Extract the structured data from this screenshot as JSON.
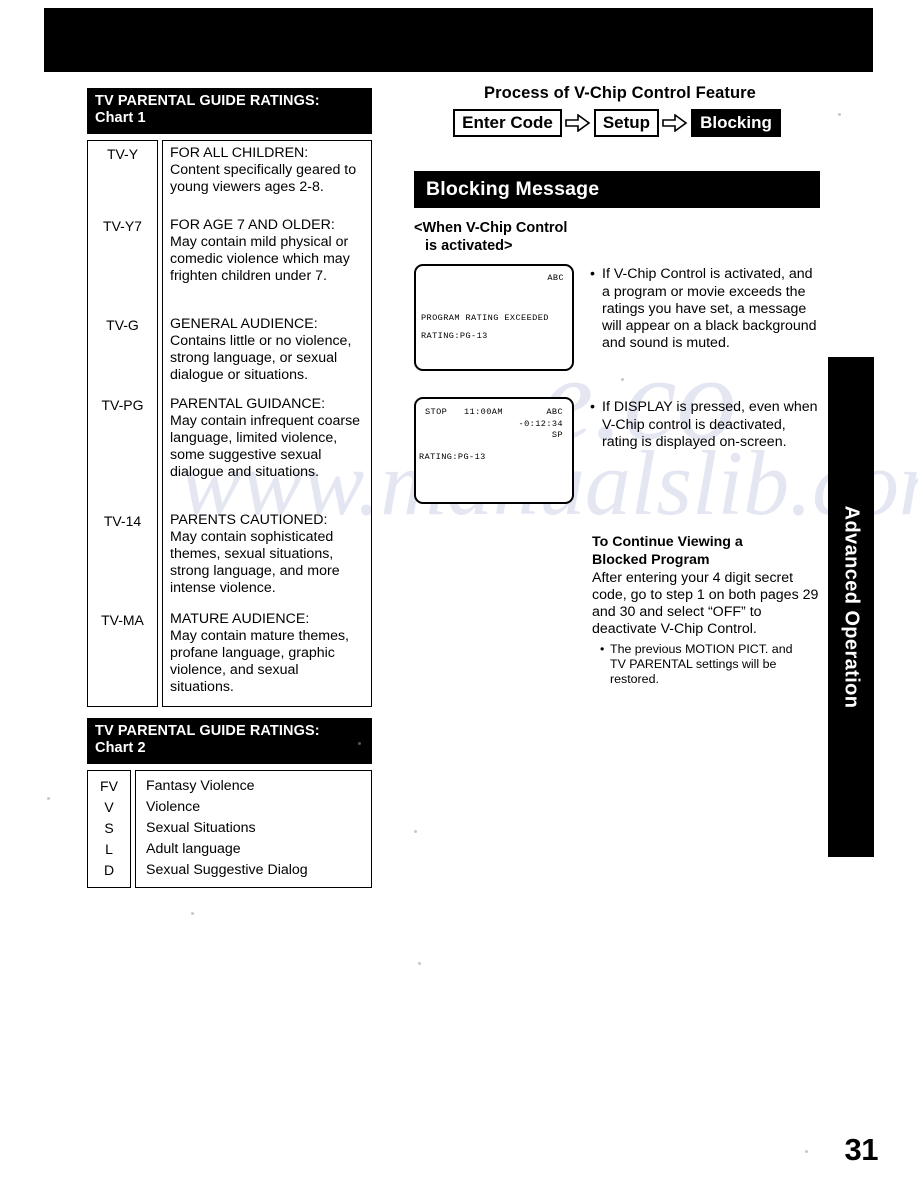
{
  "page": {
    "number": "31",
    "side_tab_label": "Advanced Operation"
  },
  "chart1": {
    "title_line1": "TV PARENTAL GUIDE RATINGS:",
    "title_line2": "Chart 1",
    "rows": [
      {
        "code": "TV-Y",
        "heading": "FOR ALL CHILDREN:",
        "body": "Content specifically geared to young viewers ages 2-8."
      },
      {
        "code": "TV-Y7",
        "heading": "FOR AGE 7 AND OLDER:",
        "body": "May contain mild physical or comedic violence which may frighten children under 7."
      },
      {
        "code": "TV-G",
        "heading": "GENERAL AUDIENCE:",
        "body": "Contains little or no violence, strong language, or sexual dialogue or situations."
      },
      {
        "code": "TV-PG",
        "heading": "PARENTAL GUIDANCE:",
        "body": "May contain infrequent coarse language, limited violence, some suggestive sexual dialogue and situations."
      },
      {
        "code": "TV-14",
        "heading": "PARENTS CAUTIONED:",
        "body": "May contain sophisticated themes, sexual situations, strong language, and more intense violence."
      },
      {
        "code": "TV-MA",
        "heading": "MATURE AUDIENCE:",
        "body": "May contain mature themes, profane language, graphic violence, and sexual situations."
      }
    ]
  },
  "chart2": {
    "title_line1": "TV PARENTAL GUIDE RATINGS:",
    "title_line2": "Chart 2",
    "rows": [
      {
        "code": "FV",
        "desc": "Fantasy Violence"
      },
      {
        "code": "V",
        "desc": "Violence"
      },
      {
        "code": "S",
        "desc": "Sexual Situations"
      },
      {
        "code": "L",
        "desc": "Adult language"
      },
      {
        "code": "D",
        "desc": "Sexual Suggestive Dialog"
      }
    ]
  },
  "process": {
    "title": "Process of V-Chip Control Feature",
    "steps": [
      {
        "label": "Enter Code",
        "highlighted": false
      },
      {
        "label": "Setup",
        "highlighted": false
      },
      {
        "label": "Blocking",
        "highlighted": true
      }
    ]
  },
  "blocking": {
    "section_title": "Blocking Message",
    "activated_head_line1": "<When V-Chip Control",
    "activated_head_line2": "is activated>",
    "screen1": {
      "channel": "ABC",
      "message": "PROGRAM RATING EXCEEDED",
      "rating": "RATING:PG-13"
    },
    "bullet1": "If V-Chip Control is activated, and a program or movie exceeds the ratings you have set, a message will appear on a black background and sound is muted.",
    "screen2": {
      "mode": "STOP",
      "time": "11:00AM",
      "channel": "ABC",
      "counter": "-0:12:34",
      "speed": "SP",
      "rating": "RATING:PG-13"
    },
    "bullet2": "If DISPLAY is pressed, even when V-Chip control is deactivated, rating is displayed on-screen.",
    "continue": {
      "head_line1": "To Continue Viewing a",
      "head_line2": "Blocked Program",
      "body": "After entering your 4 digit secret code, go to step 1 on both pages 29 and 30 and select “OFF” to deactivate V-Chip Control.",
      "sub_line1": "The previous MOTION PICT. and",
      "sub_line2": "TV PARENTAL settings will be",
      "sub_line3": "restored."
    }
  },
  "colors": {
    "ink": "#000000",
    "paper": "#ffffff",
    "watermark": "#7886be"
  }
}
